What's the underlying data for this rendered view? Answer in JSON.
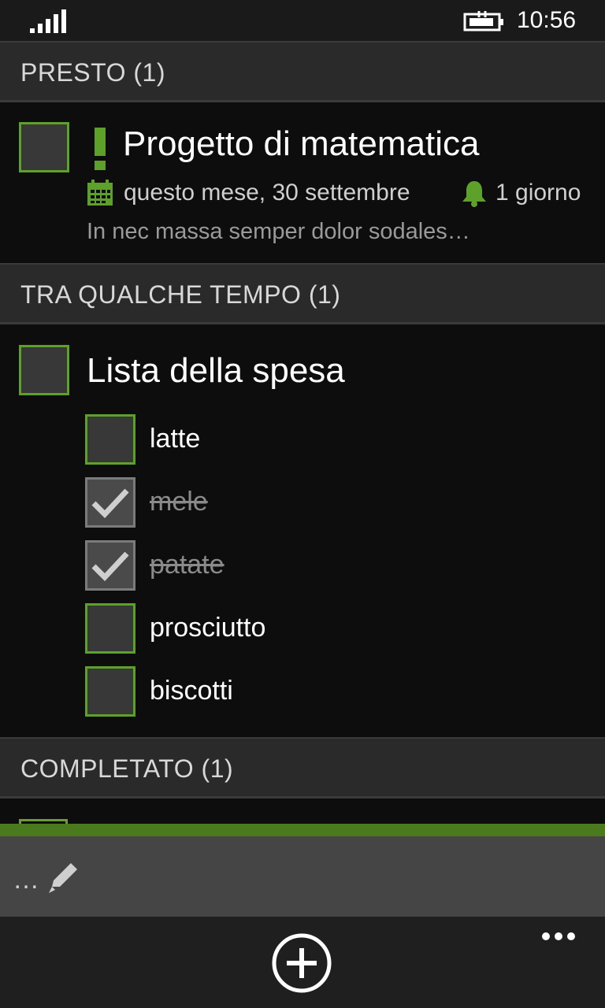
{
  "status": {
    "time": "10:56",
    "signal_icon": "signal-bars-icon",
    "battery_icon": "battery-charging-icon"
  },
  "colors": {
    "accent": "#5da12b",
    "header_bg": "#2a2a2a",
    "body_bg": "#0d0d0d"
  },
  "sections": [
    {
      "header": "PRESTO (1)",
      "task": {
        "title": "Progetto di matematica",
        "priority_icon": "exclamation-icon",
        "due": "questo mese, 30 settembre",
        "reminder": "1 giorno",
        "note": "In nec massa semper dolor sodales…"
      }
    },
    {
      "header": "TRA QUALCHE TEMPO (1)",
      "task": {
        "title": "Lista della spesa",
        "subitems": [
          {
            "label": "latte",
            "checked": false
          },
          {
            "label": "mele",
            "checked": true
          },
          {
            "label": "patate",
            "checked": true
          },
          {
            "label": "prosciutto",
            "checked": false
          },
          {
            "label": "biscotti",
            "checked": false
          }
        ]
      }
    },
    {
      "header": "COMPLETATO (1)"
    }
  ],
  "bottom_panel": {
    "more_text": "…",
    "edit_icon": "pencil-icon"
  },
  "appbar": {
    "add_icon": "add-circle-icon",
    "more_icon": "ellipsis-icon"
  }
}
